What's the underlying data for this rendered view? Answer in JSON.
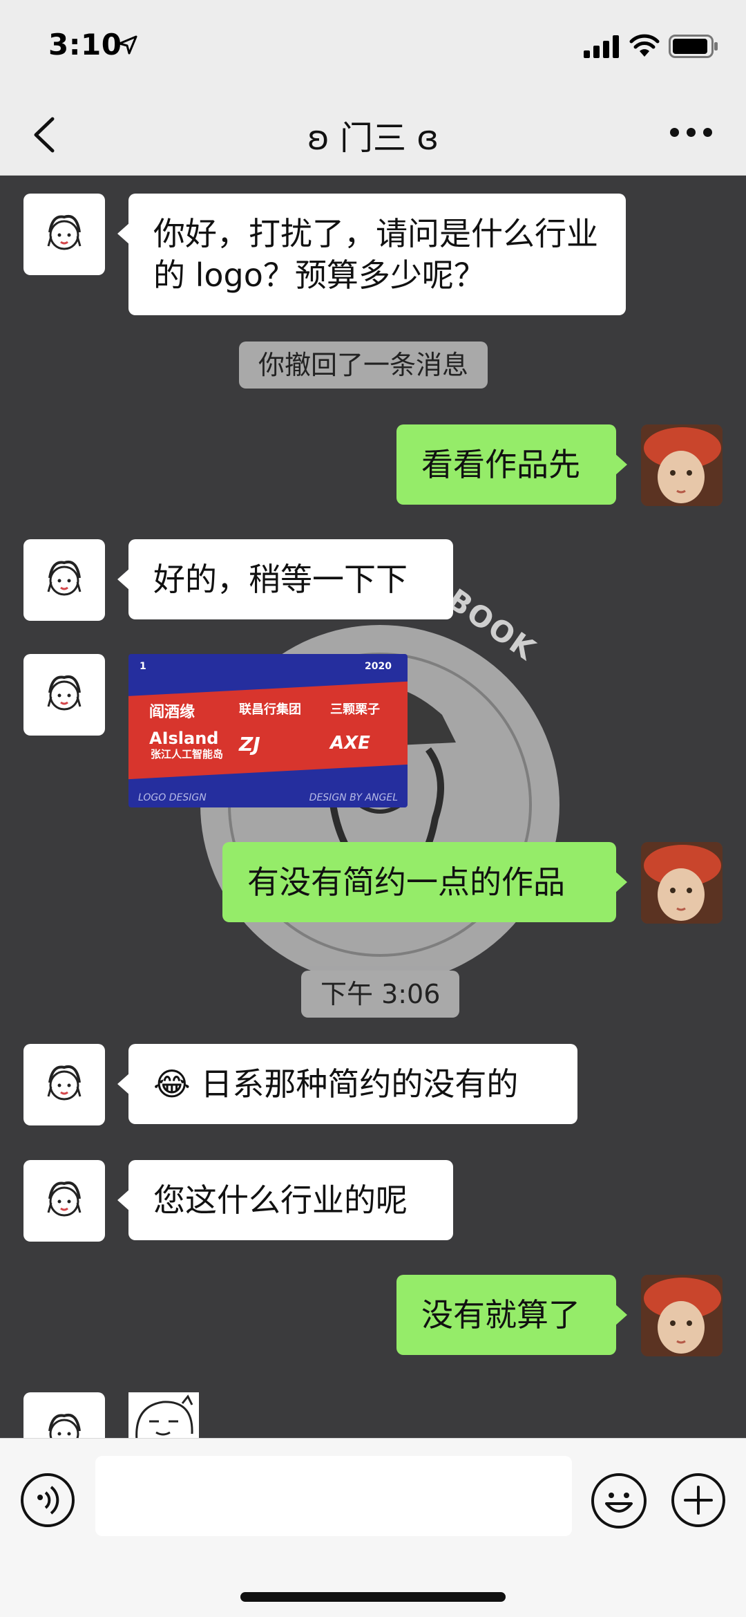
{
  "status_bar": {
    "time": "3:10"
  },
  "nav": {
    "title": "ʚ 门三 ɞ"
  },
  "messages": {
    "m1": "你好，打扰了，请问是什么行业的 logo？预算多少呢？",
    "sys1": "你撤回了一条消息",
    "m2": "看看作品先",
    "m3": "好的，稍等一下下",
    "m4": "有没有简约一点的作品",
    "sys2": "下午 3:06",
    "m5_emoji": "😂",
    "m5": "日系那种简约的没有的",
    "m6": "您这什么行业的呢",
    "m7": "没有就算了"
  },
  "image_card": {
    "tag_left": "1",
    "tag_right": "2020",
    "logos": [
      "阎酒缘",
      "联昌行集团",
      "三颗栗子",
      "AIsland",
      "张江人工智能岛",
      "ZJ",
      "AXE"
    ],
    "footer_left": "LOGO DESIGN",
    "footer_right": "DESIGN BY ANGEL"
  },
  "background_poster": {
    "text": "BOOK"
  },
  "input": {
    "placeholder": ""
  },
  "icons": {
    "back": "chevron-left-icon",
    "more": "ellipsis-icon",
    "voice": "voice-icon",
    "emoji": "emoji-icon",
    "plus": "plus-icon"
  },
  "colors": {
    "incoming_bubble": "#ffffff",
    "outgoing_bubble": "#95ec69",
    "chat_background": "#3b3b3d",
    "system_notice": "#a9a9a9"
  }
}
